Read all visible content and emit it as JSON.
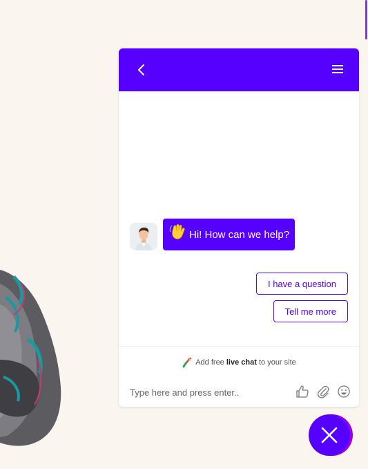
{
  "theme": {
    "accent": "#5600ff",
    "background": "#faf5ef"
  },
  "header": {
    "back_icon": "chevron-left-icon",
    "menu_icon": "hamburger-menu-icon"
  },
  "conversation": {
    "bot_greeting": "Hi! How can we help?",
    "greeting_emoji": "waving-hand-icon"
  },
  "quick_replies": [
    {
      "label": "I have a question"
    },
    {
      "label": "Tell me more"
    }
  ],
  "branding": {
    "prefix": "Add free",
    "bold": "live chat",
    "suffix": "to your site"
  },
  "composer": {
    "placeholder": "Type here and press enter.."
  }
}
